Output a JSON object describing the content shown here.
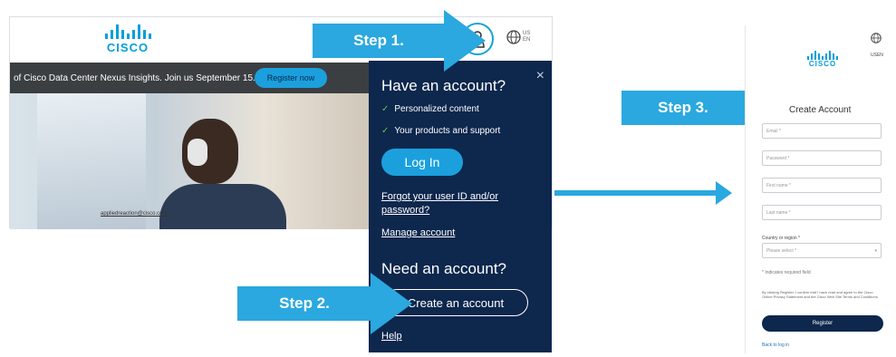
{
  "left": {
    "logo_text": "CISCO",
    "globe_lines": [
      "US",
      "EN"
    ],
    "banner_text": "of Cisco Data Center Nexus Insights. Join us September 15.",
    "register_now": "Register now",
    "hero_caption": "appliedreaction@cisco.com"
  },
  "dropdown": {
    "close_icon": "×",
    "have_account": "Have an account?",
    "benefits": [
      "Personalized content",
      "Your products and support"
    ],
    "check_glyph": "✓",
    "login": "Log In",
    "forgot_line1": "Forgot your user ID and/or",
    "forgot_line2": "password?",
    "manage": "Manage account",
    "need_account": "Need an account?",
    "create_account": "Create an account",
    "help": "Help"
  },
  "steps": {
    "step1": "Step 1.",
    "step2": "Step 2.",
    "step3": "Step 3."
  },
  "right": {
    "logo_text": "CISCO",
    "globe_lines": [
      "US",
      "EN"
    ],
    "title": "Create Account",
    "fields": [
      "Email *",
      "Password *",
      "First name *",
      "Last name *"
    ],
    "country_label": "Country or region *",
    "country_select": "Please select *",
    "required_note": "* Indicates required field",
    "legal_text": "By clicking Register, I confirm that I have read and agree to the Cisco Online Privacy Statement and the Cisco Web Site Terms and Conditions.",
    "register": "Register",
    "back": "Back to log in"
  },
  "colors": {
    "accent": "#2aa8df",
    "navy": "#0d274d",
    "cisco_blue": "#049fd9"
  },
  "icons": {
    "user": "user-icon",
    "globe": "globe-icon",
    "close": "close-icon",
    "check": "check-icon"
  }
}
